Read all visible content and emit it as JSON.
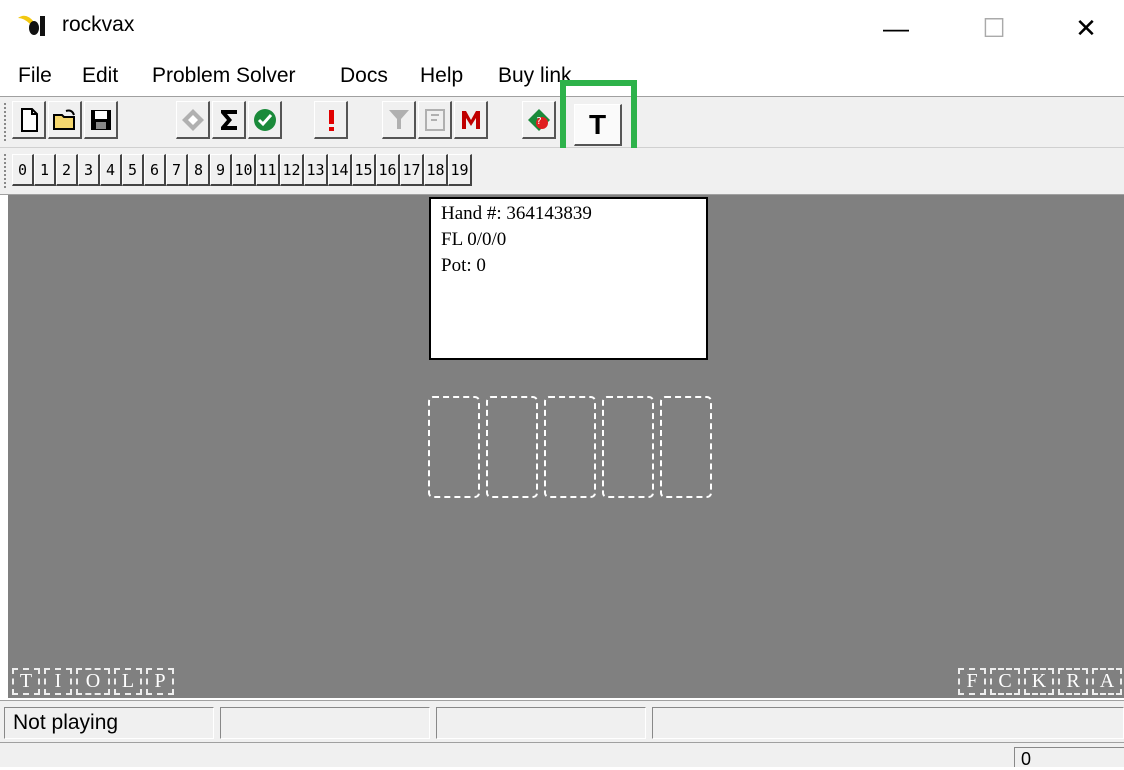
{
  "window": {
    "title": "rockvax",
    "minimize": "—",
    "maximize": "☐",
    "close": "✕"
  },
  "menu": {
    "items": [
      "File",
      "Edit",
      "Problem Solver",
      "Docs",
      "Help",
      "Buy link"
    ]
  },
  "toolbar": {
    "icons": [
      "new-file-icon",
      "open-folder-icon",
      "save-icon",
      "diamond-icon",
      "sigma-icon",
      "check-icon",
      "exclamation-icon",
      "filter-icon",
      "card-icon",
      "m-icon",
      "help-icon"
    ],
    "t_label": "T"
  },
  "seat_bar": {
    "labels": [
      "0",
      "1",
      "2",
      "3",
      "4",
      "5",
      "6",
      "7",
      "8",
      "9",
      "10",
      "11",
      "12",
      "13",
      "14",
      "15",
      "16",
      "17",
      "18",
      "19"
    ]
  },
  "hand_info": {
    "hand_number": "Hand #: 364143839",
    "fl": "FL 0/0/0",
    "pot": "Pot: 0"
  },
  "board": {
    "card_slots": 5
  },
  "left_actions": [
    "T",
    "I",
    "O",
    "L",
    "P"
  ],
  "right_actions": [
    "F",
    "C",
    "K",
    "R",
    "A"
  ],
  "status": {
    "state": "Not playing",
    "panel2": "",
    "panel3": "",
    "panel4": "",
    "counter": "0"
  },
  "colors": {
    "table": "#808080",
    "highlight": "#2db24a"
  }
}
